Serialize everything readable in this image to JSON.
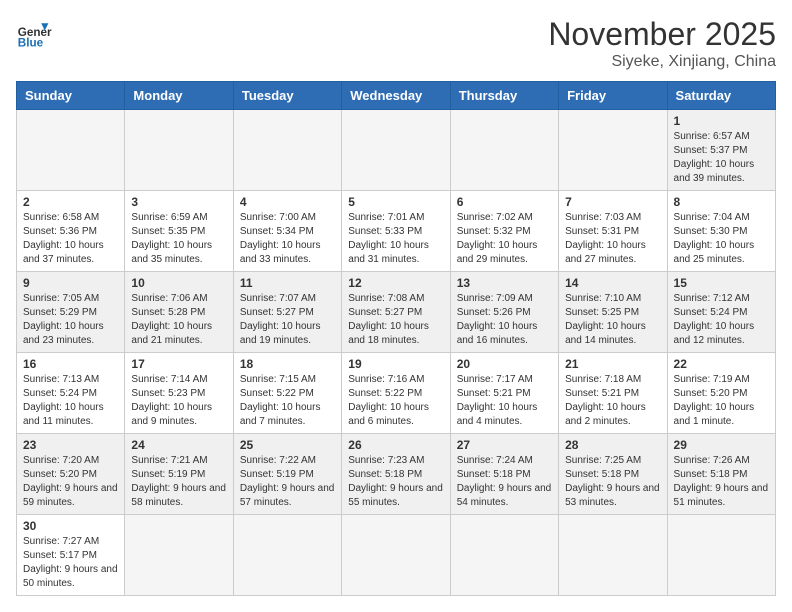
{
  "logo": {
    "text_general": "General",
    "text_blue": "Blue"
  },
  "header": {
    "month": "November 2025",
    "location": "Siyeke, Xinjiang, China"
  },
  "weekdays": [
    "Sunday",
    "Monday",
    "Tuesday",
    "Wednesday",
    "Thursday",
    "Friday",
    "Saturday"
  ],
  "weeks": [
    [
      {
        "day": "",
        "info": ""
      },
      {
        "day": "",
        "info": ""
      },
      {
        "day": "",
        "info": ""
      },
      {
        "day": "",
        "info": ""
      },
      {
        "day": "",
        "info": ""
      },
      {
        "day": "",
        "info": ""
      },
      {
        "day": "1",
        "info": "Sunrise: 6:57 AM\nSunset: 5:37 PM\nDaylight: 10 hours and 39 minutes."
      }
    ],
    [
      {
        "day": "2",
        "info": "Sunrise: 6:58 AM\nSunset: 5:36 PM\nDaylight: 10 hours and 37 minutes."
      },
      {
        "day": "3",
        "info": "Sunrise: 6:59 AM\nSunset: 5:35 PM\nDaylight: 10 hours and 35 minutes."
      },
      {
        "day": "4",
        "info": "Sunrise: 7:00 AM\nSunset: 5:34 PM\nDaylight: 10 hours and 33 minutes."
      },
      {
        "day": "5",
        "info": "Sunrise: 7:01 AM\nSunset: 5:33 PM\nDaylight: 10 hours and 31 minutes."
      },
      {
        "day": "6",
        "info": "Sunrise: 7:02 AM\nSunset: 5:32 PM\nDaylight: 10 hours and 29 minutes."
      },
      {
        "day": "7",
        "info": "Sunrise: 7:03 AM\nSunset: 5:31 PM\nDaylight: 10 hours and 27 minutes."
      },
      {
        "day": "8",
        "info": "Sunrise: 7:04 AM\nSunset: 5:30 PM\nDaylight: 10 hours and 25 minutes."
      }
    ],
    [
      {
        "day": "9",
        "info": "Sunrise: 7:05 AM\nSunset: 5:29 PM\nDaylight: 10 hours and 23 minutes."
      },
      {
        "day": "10",
        "info": "Sunrise: 7:06 AM\nSunset: 5:28 PM\nDaylight: 10 hours and 21 minutes."
      },
      {
        "day": "11",
        "info": "Sunrise: 7:07 AM\nSunset: 5:27 PM\nDaylight: 10 hours and 19 minutes."
      },
      {
        "day": "12",
        "info": "Sunrise: 7:08 AM\nSunset: 5:27 PM\nDaylight: 10 hours and 18 minutes."
      },
      {
        "day": "13",
        "info": "Sunrise: 7:09 AM\nSunset: 5:26 PM\nDaylight: 10 hours and 16 minutes."
      },
      {
        "day": "14",
        "info": "Sunrise: 7:10 AM\nSunset: 5:25 PM\nDaylight: 10 hours and 14 minutes."
      },
      {
        "day": "15",
        "info": "Sunrise: 7:12 AM\nSunset: 5:24 PM\nDaylight: 10 hours and 12 minutes."
      }
    ],
    [
      {
        "day": "16",
        "info": "Sunrise: 7:13 AM\nSunset: 5:24 PM\nDaylight: 10 hours and 11 minutes."
      },
      {
        "day": "17",
        "info": "Sunrise: 7:14 AM\nSunset: 5:23 PM\nDaylight: 10 hours and 9 minutes."
      },
      {
        "day": "18",
        "info": "Sunrise: 7:15 AM\nSunset: 5:22 PM\nDaylight: 10 hours and 7 minutes."
      },
      {
        "day": "19",
        "info": "Sunrise: 7:16 AM\nSunset: 5:22 PM\nDaylight: 10 hours and 6 minutes."
      },
      {
        "day": "20",
        "info": "Sunrise: 7:17 AM\nSunset: 5:21 PM\nDaylight: 10 hours and 4 minutes."
      },
      {
        "day": "21",
        "info": "Sunrise: 7:18 AM\nSunset: 5:21 PM\nDaylight: 10 hours and 2 minutes."
      },
      {
        "day": "22",
        "info": "Sunrise: 7:19 AM\nSunset: 5:20 PM\nDaylight: 10 hours and 1 minute."
      }
    ],
    [
      {
        "day": "23",
        "info": "Sunrise: 7:20 AM\nSunset: 5:20 PM\nDaylight: 9 hours and 59 minutes."
      },
      {
        "day": "24",
        "info": "Sunrise: 7:21 AM\nSunset: 5:19 PM\nDaylight: 9 hours and 58 minutes."
      },
      {
        "day": "25",
        "info": "Sunrise: 7:22 AM\nSunset: 5:19 PM\nDaylight: 9 hours and 57 minutes."
      },
      {
        "day": "26",
        "info": "Sunrise: 7:23 AM\nSunset: 5:18 PM\nDaylight: 9 hours and 55 minutes."
      },
      {
        "day": "27",
        "info": "Sunrise: 7:24 AM\nSunset: 5:18 PM\nDaylight: 9 hours and 54 minutes."
      },
      {
        "day": "28",
        "info": "Sunrise: 7:25 AM\nSunset: 5:18 PM\nDaylight: 9 hours and 53 minutes."
      },
      {
        "day": "29",
        "info": "Sunrise: 7:26 AM\nSunset: 5:18 PM\nDaylight: 9 hours and 51 minutes."
      }
    ],
    [
      {
        "day": "30",
        "info": "Sunrise: 7:27 AM\nSunset: 5:17 PM\nDaylight: 9 hours and 50 minutes."
      },
      {
        "day": "",
        "info": ""
      },
      {
        "day": "",
        "info": ""
      },
      {
        "day": "",
        "info": ""
      },
      {
        "day": "",
        "info": ""
      },
      {
        "day": "",
        "info": ""
      },
      {
        "day": "",
        "info": ""
      }
    ]
  ]
}
